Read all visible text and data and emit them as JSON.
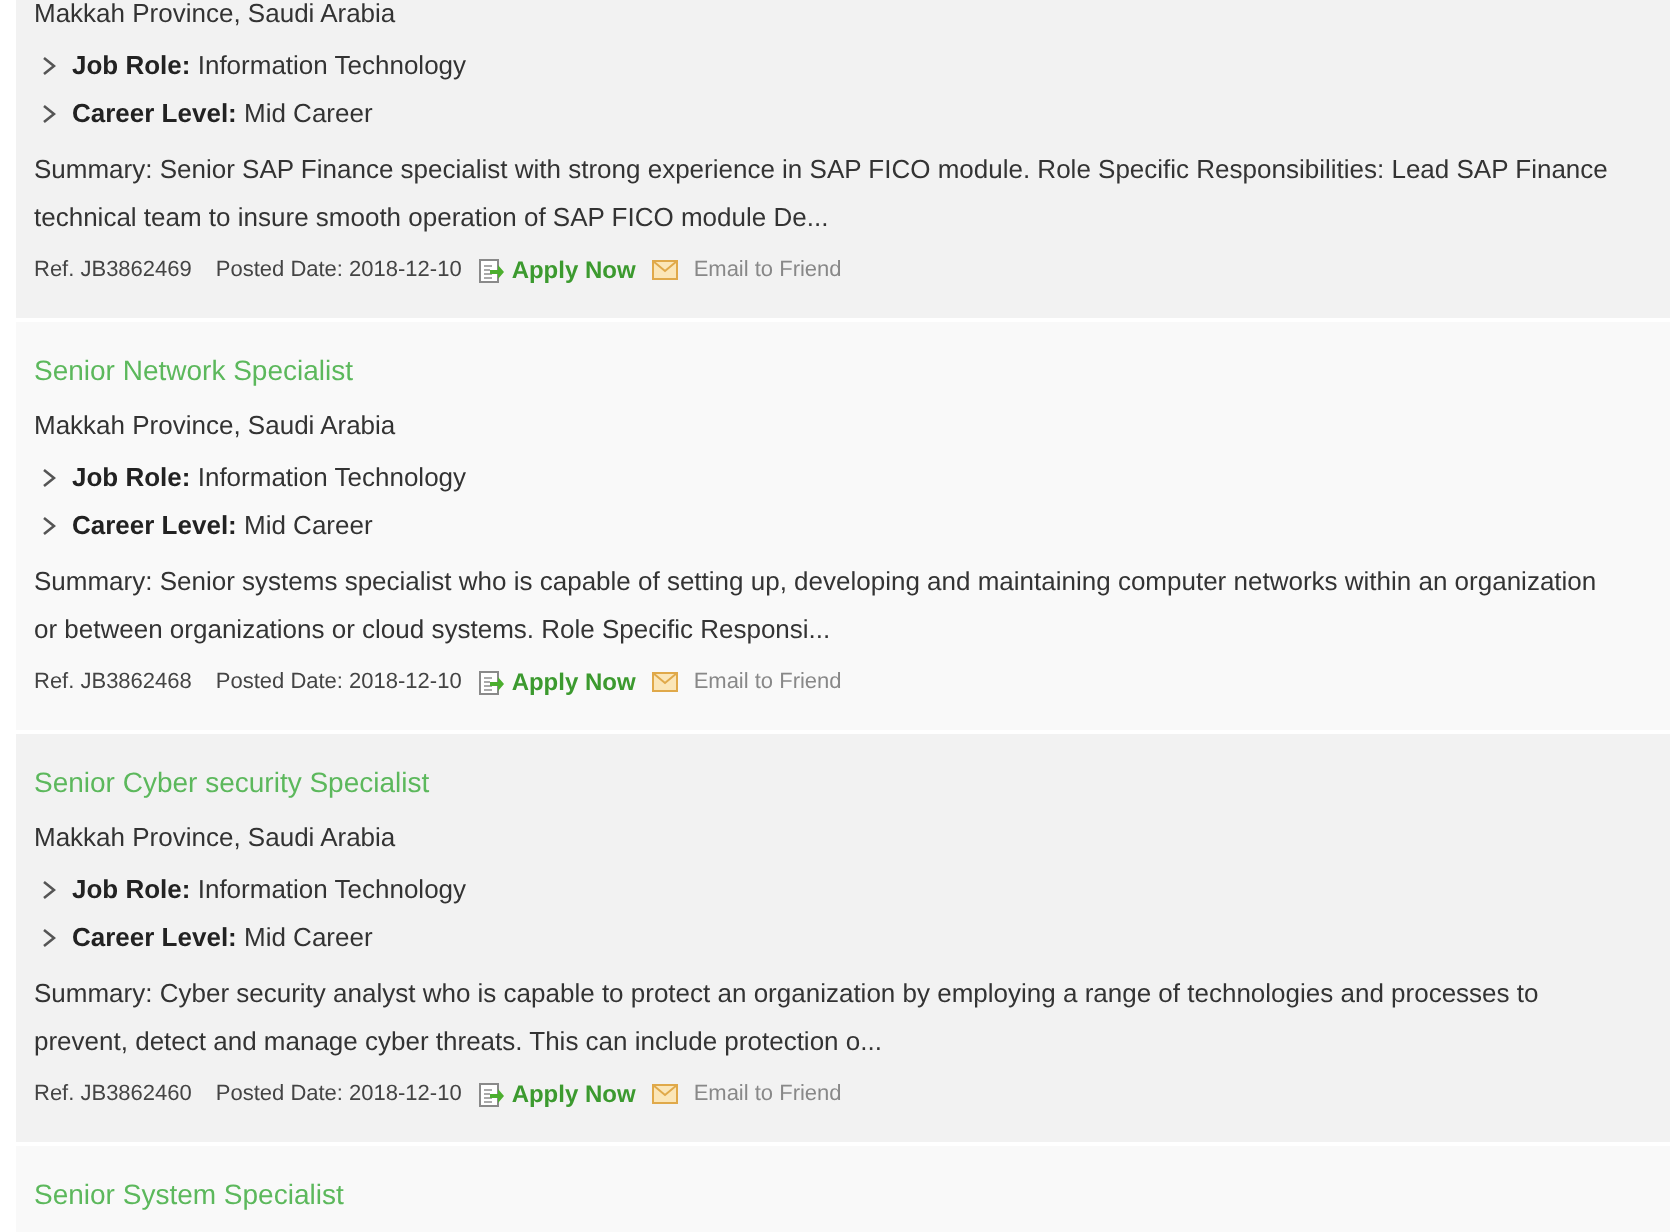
{
  "jobs": [
    {
      "location": "Makkah Province, Saudi Arabia",
      "details": [
        {
          "label": "Job Role:",
          "value": "Information Technology"
        },
        {
          "label": "Career Level:",
          "value": "Mid Career"
        }
      ],
      "summary": "Summary: Senior SAP Finance specialist with strong experience in SAP FICO module. Role Specific Responsibilities: Lead SAP Finance technical team to insure smooth operation of SAP FICO module De...",
      "ref": "Ref. JB3862469",
      "posted": "Posted Date: 2018-12-10",
      "apply": "Apply Now",
      "email": "Email to Friend"
    },
    {
      "title": "Senior Network Specialist",
      "location": "Makkah Province, Saudi Arabia",
      "details": [
        {
          "label": "Job Role:",
          "value": "Information Technology"
        },
        {
          "label": "Career Level:",
          "value": "Mid Career"
        }
      ],
      "summary": "Summary: Senior systems specialist who is capable of setting up, developing and maintaining computer networks within an organization or between organizations or cloud systems. Role Specific Responsi...",
      "ref": "Ref. JB3862468",
      "posted": "Posted Date: 2018-12-10",
      "apply": "Apply Now",
      "email": "Email to Friend"
    },
    {
      "title": "Senior Cyber security Specialist",
      "location": "Makkah Province, Saudi Arabia",
      "details": [
        {
          "label": "Job Role:",
          "value": "Information Technology"
        },
        {
          "label": "Career Level:",
          "value": "Mid Career"
        }
      ],
      "summary": "Summary: Cyber security analyst who is capable to protect an organization by employing a range of technologies and processes to prevent, detect and manage cyber threats. This can include protection o...",
      "ref": "Ref. JB3862460",
      "posted": "Posted Date: 2018-12-10",
      "apply": "Apply Now",
      "email": "Email to Friend"
    },
    {
      "title": "Senior System Specialist"
    }
  ]
}
